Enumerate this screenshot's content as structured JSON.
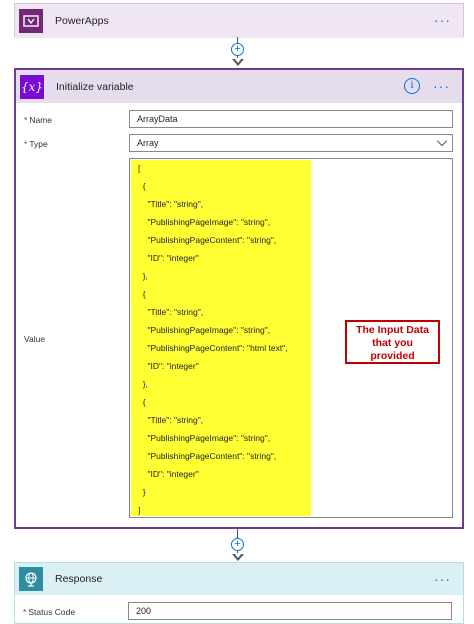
{
  "steps": {
    "powerapps": {
      "title": "PowerApps",
      "more": "···"
    },
    "init_variable": {
      "title": "Initialize variable",
      "icon_glyph": "{x}",
      "info_glyph": "i",
      "more": "···",
      "fields": {
        "name": {
          "required_mark": "*",
          "label": "Name",
          "value": "ArrayData"
        },
        "type": {
          "required_mark": "*",
          "label": "Type",
          "value": "Array"
        },
        "value": {
          "label": "Value"
        }
      },
      "json_lines": [
        "[",
        "  {",
        "    \"Title\": \"string\",",
        "    \"PublishingPageImage\": \"string\",",
        "    \"PublishingPageContent\": \"string\",",
        "    \"ID\": \"integer\"",
        "  },",
        "  {",
        "    \"Title\": \"string\",",
        "    \"PublishingPageImage\": \"string\",",
        "    \"PublishingPageContent\": \"html text\",",
        "    \"ID\": \"integer\"",
        "  },",
        "  {",
        "    \"Title\": \"string\",",
        "    \"PublishingPageImage\": \"string\",",
        "    \"PublishingPageContent\": \"string\",",
        "    \"ID\": \"integer\"",
        "  }",
        "]"
      ],
      "annotation": {
        "line1": "The Input Data",
        "line2": "that you",
        "line3": "provided"
      }
    },
    "response": {
      "title": "Response",
      "more": "···",
      "fields": {
        "status_code": {
          "required_mark": "*",
          "label": "Status Code",
          "value": "200"
        }
      }
    }
  },
  "connectors": {
    "plus_glyph": "+"
  },
  "colors": {
    "powerapps_brand": "#742774",
    "variable_brand": "#770bd6",
    "response_brand": "#2d8ea1",
    "accent": "#0078d4",
    "highlight": "#ffff33",
    "annotation": "#c00000"
  },
  "icons": {
    "powerapps": "powerapps-icon",
    "variable": "variable-icon",
    "response": "globe-icon",
    "info": "info-icon",
    "more": "more-options-icon",
    "add": "add-step-icon",
    "dropdown": "chevron-down-icon"
  }
}
